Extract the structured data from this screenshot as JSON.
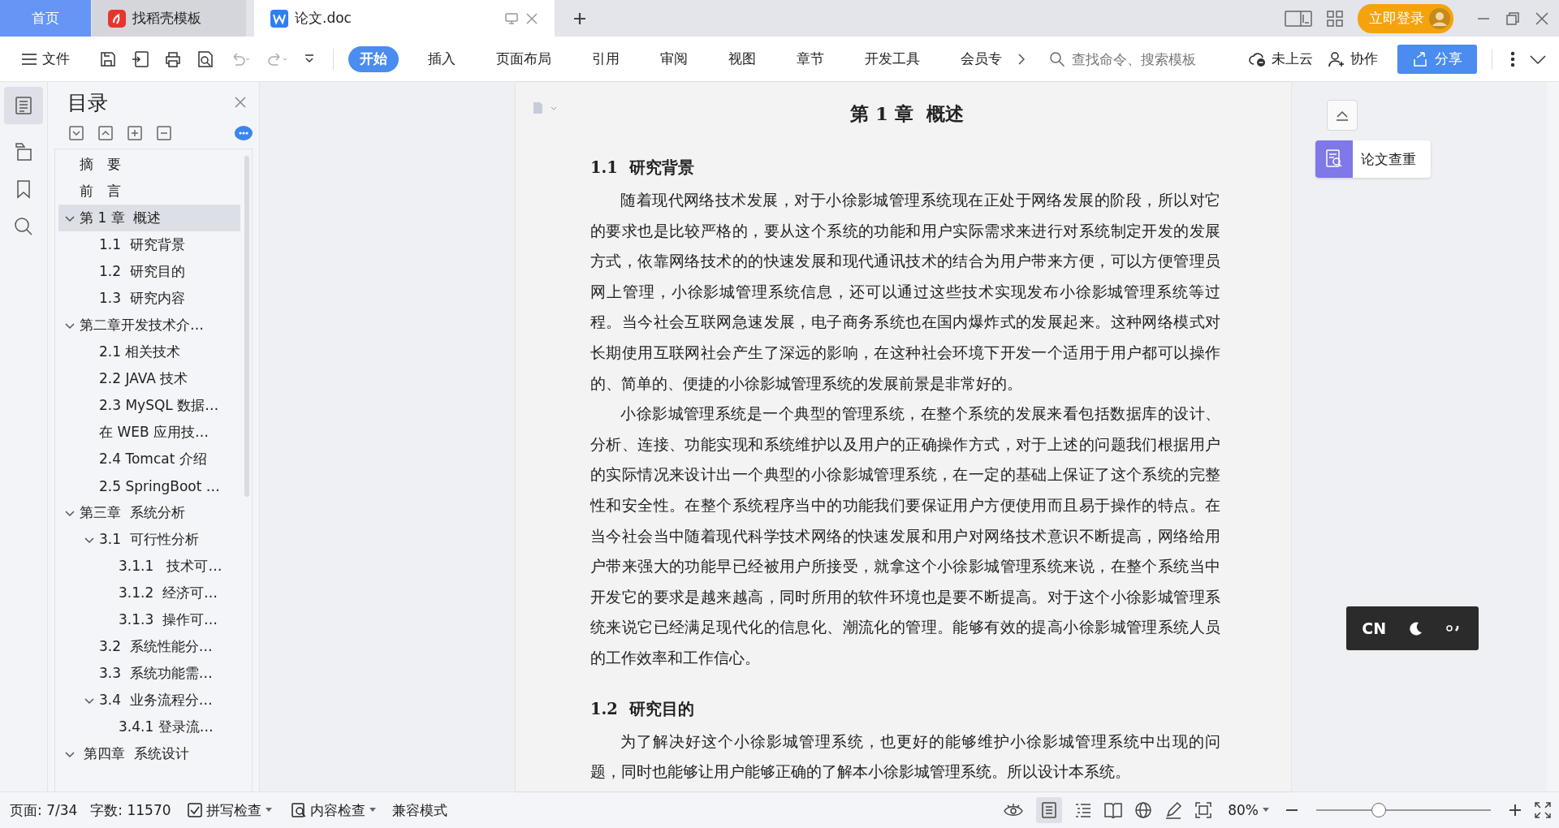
{
  "tabs": [
    {
      "label": "首页",
      "kind": "home",
      "selected": false
    },
    {
      "label": "找稻壳模板",
      "kind": "docer",
      "selected": false
    },
    {
      "label": "论文.doc",
      "kind": "doc",
      "selected": true
    }
  ],
  "account": {
    "login": "立即登录"
  },
  "toolbar": {
    "file_menu": "文件",
    "ribbon_tabs": [
      {
        "label": "开始",
        "selected": true
      },
      {
        "label": "插入",
        "selected": false
      },
      {
        "label": "页面布局",
        "selected": false
      },
      {
        "label": "引用",
        "selected": false
      },
      {
        "label": "审阅",
        "selected": false
      },
      {
        "label": "视图",
        "selected": false
      },
      {
        "label": "章节",
        "selected": false
      },
      {
        "label": "开发工具",
        "selected": false
      },
      {
        "label": "会员专",
        "selected": false
      }
    ],
    "search": {
      "placeholder": "查找命令、搜索模板"
    },
    "cloud": "未上云",
    "collaborate": "协作",
    "share": "分享"
  },
  "sidebar": {
    "title": "目录",
    "items": [
      {
        "label": "摘　要",
        "selected": false
      },
      {
        "label": "前　言",
        "selected": false
      },
      {
        "label": "第 1 章  概述",
        "selected": true,
        "expanded": true,
        "children": [
          {
            "label": "1.1  研究背景",
            "selected": false
          },
          {
            "label": "1.2  研究目的",
            "selected": false
          },
          {
            "label": "1.3  研究内容",
            "selected": false
          }
        ]
      },
      {
        "label": "第二章开发技术介…",
        "selected": false,
        "expanded": true,
        "children": [
          {
            "label": "2.1 相关技术",
            "selected": false
          },
          {
            "label": "2.2 JAVA 技术",
            "selected": false
          },
          {
            "label": "2.3 MySQL 数据…",
            "selected": false
          },
          {
            "label": "在 WEB 应用技…",
            "selected": false
          },
          {
            "label": "2.4 Tomcat 介绍",
            "selected": false
          },
          {
            "label": "2.5 SpringBoot …",
            "selected": false
          }
        ]
      },
      {
        "label": "第三章  系统分析",
        "selected": false,
        "expanded": true,
        "children": [
          {
            "label": "3.1  可行性分析",
            "selected": false,
            "expanded": true,
            "children": [
              {
                "label": "3.1.1   技术可…",
                "selected": false
              },
              {
                "label": "3.1.2  经济可…",
                "selected": false
              },
              {
                "label": "3.1.3  操作可…",
                "selected": false
              }
            ]
          },
          {
            "label": "3.2  系统性能分…",
            "selected": false
          },
          {
            "label": "3.3  系统功能需…",
            "selected": false
          },
          {
            "label": "3.4  业务流程分…",
            "selected": false,
            "expanded": true,
            "children": [
              {
                "label": "3.4.1 登录流…",
                "selected": false
              }
            ]
          }
        ]
      },
      {
        "label": " 第四章  系统设计",
        "selected": false,
        "expanded": true
      }
    ]
  },
  "document": {
    "title": "第 1 章  概述",
    "sections": [
      {
        "heading": "1.1  研究背景",
        "paragraphs": [
          "随着现代网络技术发展，对于小徐影城管理系统现在正处于网络发展的阶段，所以对它的要求也是比较严格的，要从这个系统的功能和用户实际需求来进行对系统制定开发的发展方式，依靠网络技术的的快速发展和现代通讯技术的结合为用户带来方便，可以方便管理员网上管理，小徐影城管理系统信息，还可以通过这些技术实现发布小徐影城管理系统等过程。当今社会互联网急速发展，电子商务系统也在国内爆炸式的发展起来。这种网络模式对长期使用互联网社会产生了深远的影响，在这种社会环境下开发一个适用于用户都可以操作的、简单的、便捷的小徐影城管理系统的发展前景是非常好的。",
          "小徐影城管理系统是一个典型的管理系统，在整个系统的发展来看包括数据库的设计、分析、连接、功能实现和系统维护以及用户的正确操作方式，对于上述的问题我们根据用户的实际情况来设计出一个典型的小徐影城管理系统，在一定的基础上保证了这个系统的完整性和安全性。在整个系统程序当中的功能我们要保证用户方便使用而且易于操作的特点。在当今社会当中随着现代科学技术网络的快速发展和用户对网络技术意识不断提高，网络给用户带来强大的功能早已经被用户所接受，就拿这个小徐影城管理系统来说，在整个系统当中开发它的要求是越来越高，同时所用的软件环境也是要不断提高。对于这个小徐影城管理系统来说它已经满足现代化的信息化、潮流化的管理。能够有效的提高小徐影城管理系统人员的工作效率和工作信心。"
        ]
      },
      {
        "heading": "1.2  研究目的",
        "paragraphs": [
          "为了解决好这个小徐影城管理系统，也更好的能够维护小徐影城管理系统中出现的问题，同时也能够让用户能够正确的了解本小徐影城管理系统。所以设计本系统。"
        ]
      }
    ]
  },
  "side_panel": {
    "check_button": "论文查重"
  },
  "ime_widget": {
    "label": "CN"
  },
  "status_bar": {
    "page": "页面: 7/34",
    "words": "字数: 11570",
    "spell_check": "拼写检查",
    "content_check": "内容检查",
    "mode": "兼容模式",
    "zoom": "80%",
    "zoom_slider": {
      "level": 0.36
    }
  }
}
